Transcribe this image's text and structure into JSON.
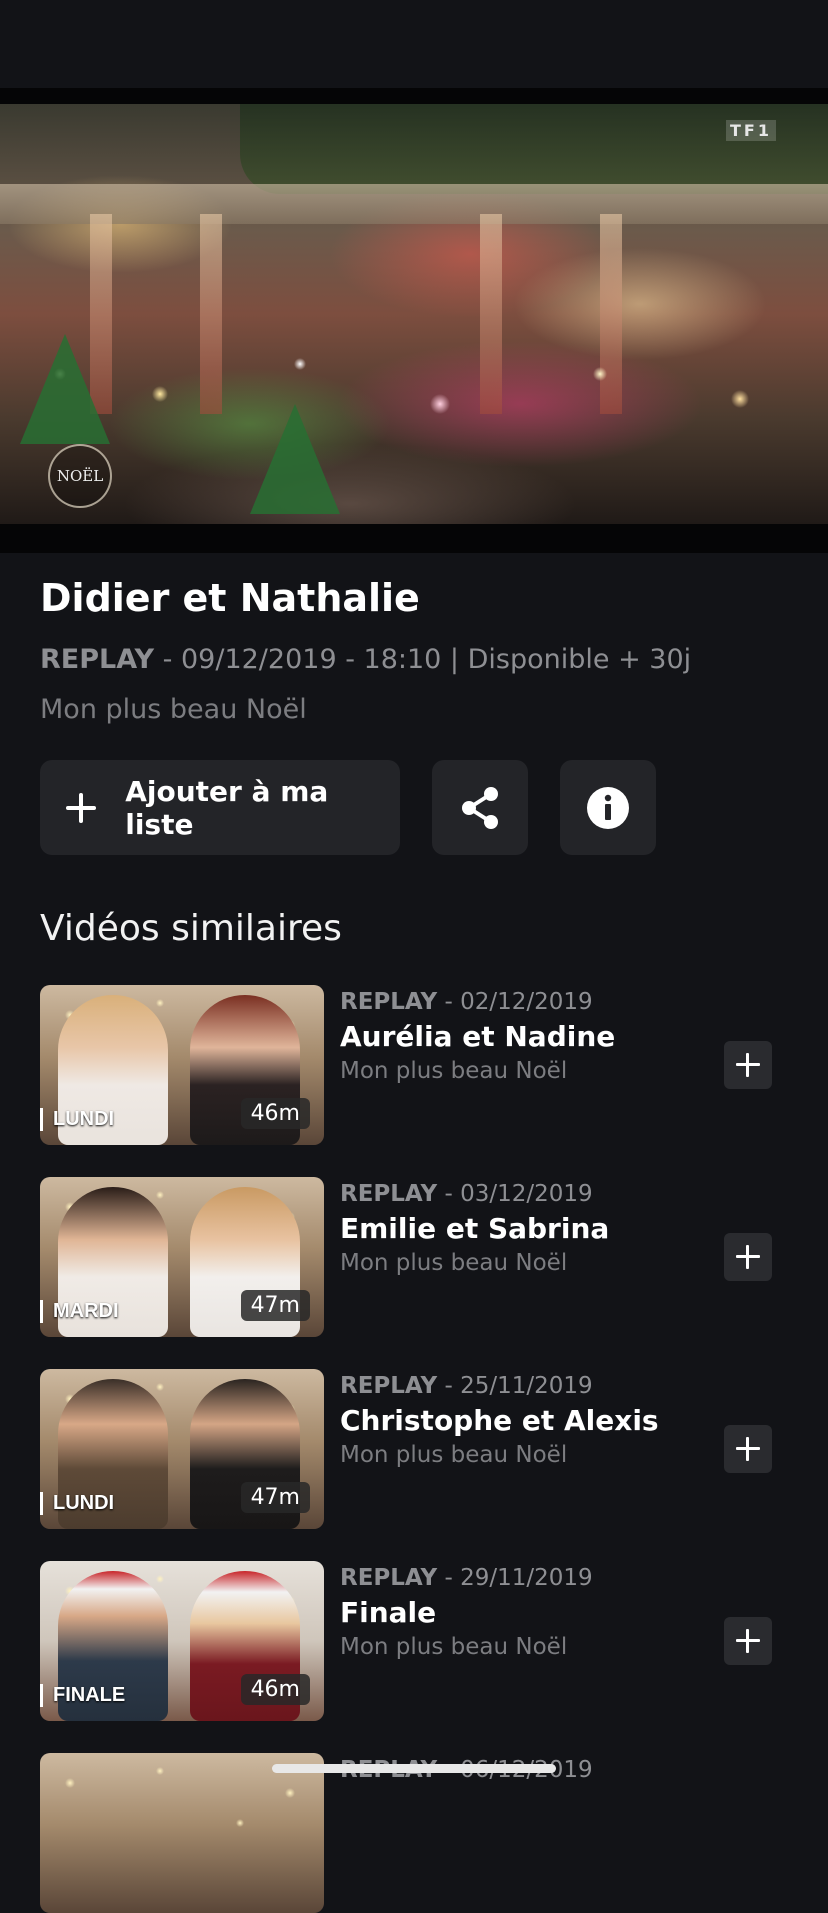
{
  "player": {
    "channel_logo": "TF1",
    "show_seal_text": "NOËL"
  },
  "program": {
    "title": "Didier et Nathalie",
    "meta_type": "REPLAY",
    "meta_details": " - 09/12/2019 - 18:10 | Disponible + 30j",
    "subtitle": "Mon plus beau Noël"
  },
  "actions": {
    "add_to_list_label": "Ajouter à ma liste",
    "add_icon": "plus-icon",
    "share_icon": "share-icon",
    "info_icon": "info-icon"
  },
  "similar": {
    "section_title": "Vidéos similaires",
    "items": [
      {
        "type": "REPLAY",
        "date": " - 02/12/2019",
        "title": "Aurélia et Nadine",
        "subtitle": "Mon plus beau Noël",
        "day_tag": "LUNDI",
        "duration": "46m"
      },
      {
        "type": "REPLAY",
        "date": " - 03/12/2019",
        "title": "Emilie et Sabrina",
        "subtitle": "Mon plus beau Noël",
        "day_tag": "MARDI",
        "duration": "47m"
      },
      {
        "type": "REPLAY",
        "date": " - 25/11/2019",
        "title": "Christophe et Alexis",
        "subtitle": "Mon plus beau Noël",
        "day_tag": "LUNDI",
        "duration": "47m"
      },
      {
        "type": "REPLAY",
        "date": " - 29/11/2019",
        "title": "Finale",
        "subtitle": "Mon plus beau Noël",
        "day_tag": "FINALE",
        "duration": "46m"
      },
      {
        "type": "REPLAY",
        "date": " - 06/12/2019",
        "title": "",
        "subtitle": "",
        "day_tag": "",
        "duration": ""
      }
    ]
  },
  "colors": {
    "background": "#121317",
    "button_bg": "#232428",
    "muted_text": "#8e8f93"
  }
}
